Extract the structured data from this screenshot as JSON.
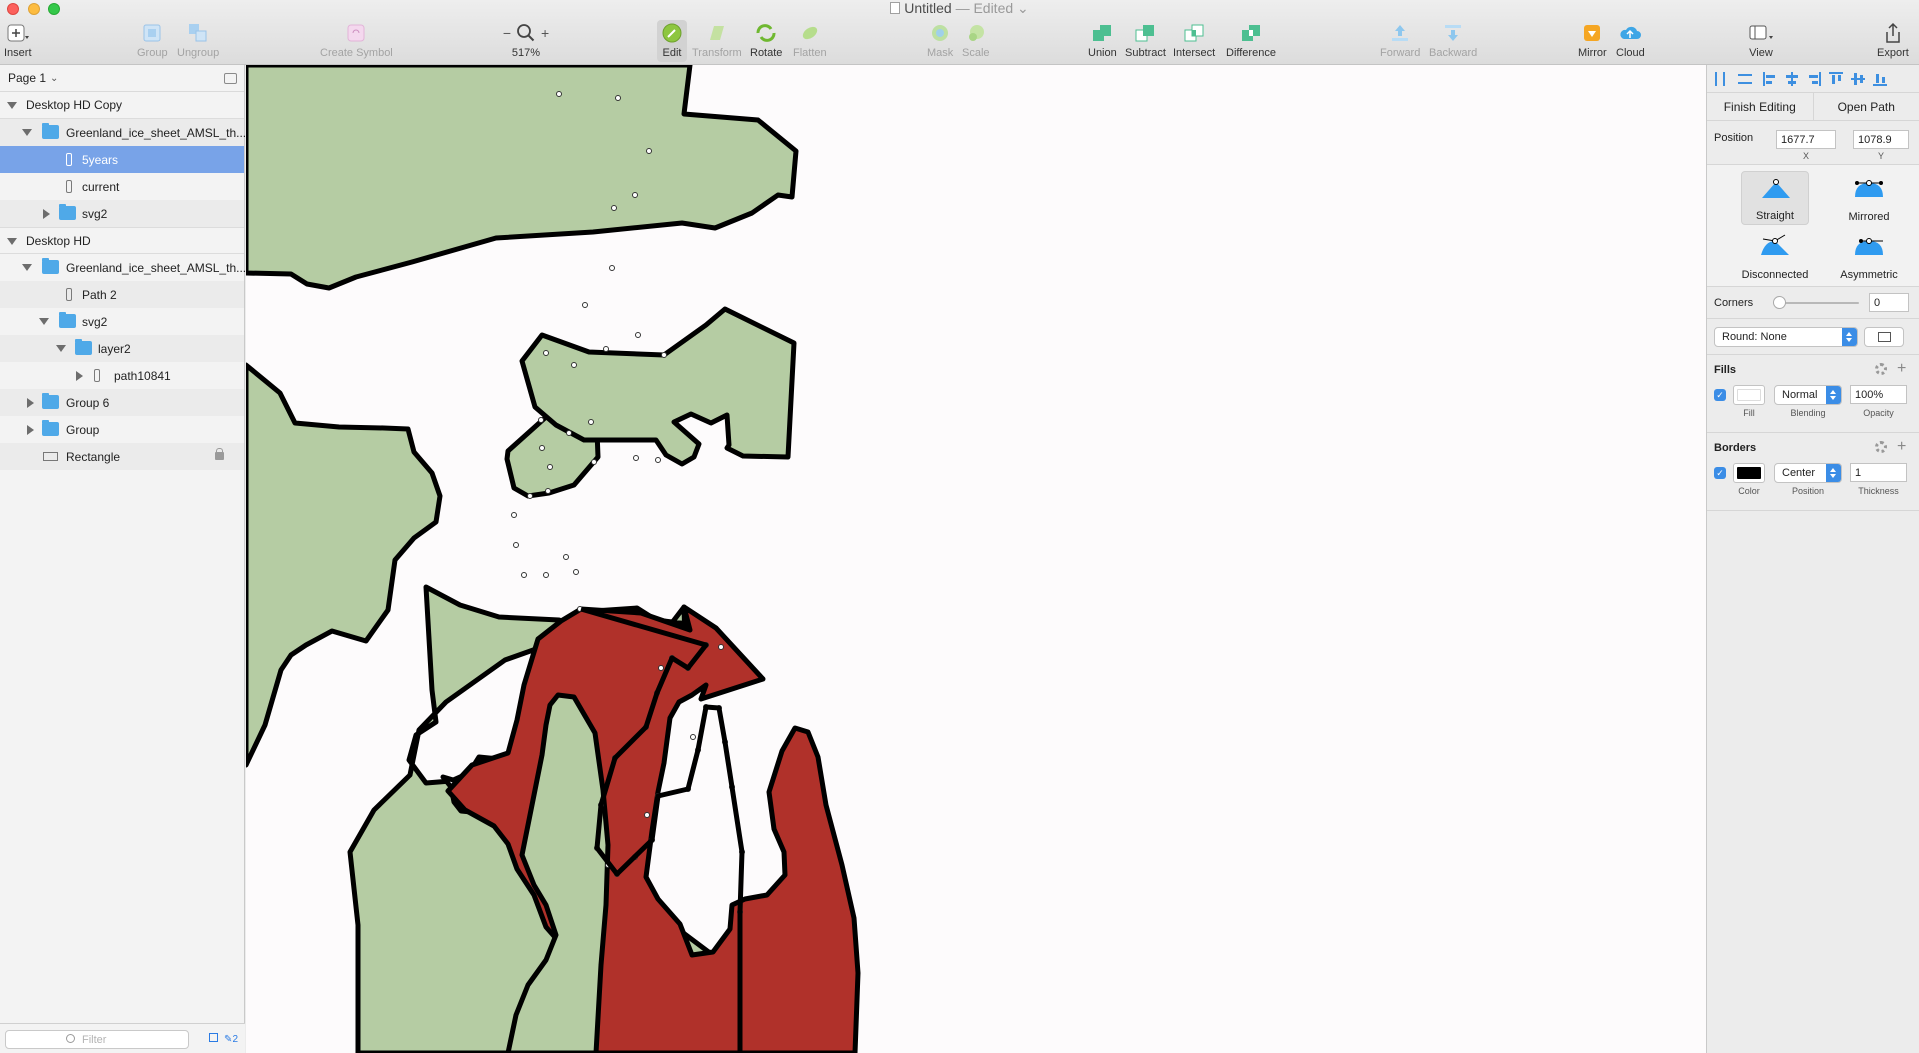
{
  "window": {
    "title": "Untitled",
    "status": "— Edited"
  },
  "toolbar": {
    "insert": "Insert",
    "group": "Group",
    "ungroup": "Ungroup",
    "create_symbol": "Create Symbol",
    "zoom_minus": "−",
    "zoom_plus": "+",
    "zoom_level": "517%",
    "edit": "Edit",
    "transform": "Transform",
    "rotate": "Rotate",
    "flatten": "Flatten",
    "mask": "Mask",
    "scale": "Scale",
    "union": "Union",
    "subtract": "Subtract",
    "intersect": "Intersect",
    "difference": "Difference",
    "forward": "Forward",
    "backward": "Backward",
    "mirror": "Mirror",
    "cloud": "Cloud",
    "view": "View",
    "export": "Export"
  },
  "layers": {
    "page": "Page 1",
    "items": [
      {
        "label": "Desktop HD Copy"
      },
      {
        "label": "Greenland_ice_sheet_AMSL_th..."
      },
      {
        "label": "5years"
      },
      {
        "label": "current"
      },
      {
        "label": "svg2"
      },
      {
        "label": "Desktop HD"
      },
      {
        "label": "Greenland_ice_sheet_AMSL_th..."
      },
      {
        "label": "Path 2"
      },
      {
        "label": "svg2"
      },
      {
        "label": "layer2"
      },
      {
        "label": "path10841"
      },
      {
        "label": "Group 6"
      },
      {
        "label": "Group"
      },
      {
        "label": "Rectangle"
      }
    ],
    "filter_placeholder": "Filter",
    "count": "2"
  },
  "inspector": {
    "finish_editing": "Finish Editing",
    "open_path": "Open Path",
    "position_label": "Position",
    "x_value": "1677.7",
    "y_value": "1078.9",
    "x_label": "X",
    "y_label": "Y",
    "point_types": [
      "Straight",
      "Mirrored",
      "Disconnected",
      "Asymmetric"
    ],
    "selected_point_type": "Straight",
    "corners_label": "Corners",
    "corners_value": "0",
    "round_select": "Round: None",
    "fills": {
      "title": "Fills",
      "enabled": true,
      "color": "#ffffff",
      "blending": "Normal",
      "opacity": "100%",
      "fill_label": "Fill",
      "blending_label": "Blending",
      "opacity_label": "Opacity"
    },
    "borders": {
      "title": "Borders",
      "enabled": true,
      "color": "#000000",
      "position": "Center",
      "thickness": "1",
      "color_label": "Color",
      "position_label": "Position",
      "thickness_label": "Thickness"
    }
  },
  "colors": {
    "land_green": "#b5cca3",
    "highlight_red": "#b0312a",
    "accent_blue": "#3b8de6",
    "selection_blue": "#78a3e8"
  }
}
